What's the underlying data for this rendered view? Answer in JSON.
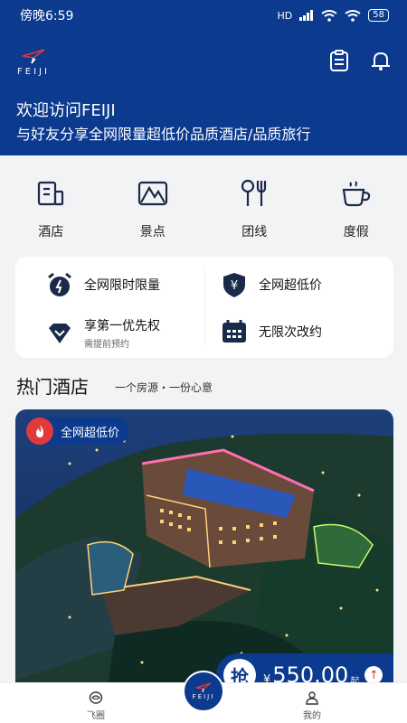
{
  "status": {
    "time": "傍晚6:59",
    "network": "HD",
    "battery": "58"
  },
  "header": {
    "logo_text": "FEIJI",
    "welcome": "欢迎访问FEIJI",
    "slogan": "与好友分享全网限量超低价品质酒店/品质旅行"
  },
  "categories": [
    {
      "label": "酒店",
      "icon": "hotel-icon"
    },
    {
      "label": "景点",
      "icon": "mountain-icon"
    },
    {
      "label": "团线",
      "icon": "tour-icon"
    },
    {
      "label": "度假",
      "icon": "coffee-icon"
    }
  ],
  "features": [
    {
      "title": "全网限时限量",
      "sub": "",
      "icon": "alarm-clock-icon"
    },
    {
      "title": "全网超低价",
      "sub": "",
      "icon": "yen-shield-icon"
    },
    {
      "title": "享第一优先权",
      "sub": "需提前预约",
      "icon": "diamond-icon"
    },
    {
      "title": "无限次改约",
      "sub": "",
      "icon": "calendar-icon"
    }
  ],
  "section": {
    "title": "热门酒店",
    "subtitle": "一个房源・一份心意"
  },
  "hotel": {
    "badge": "全网超低价",
    "grab_label": "抢",
    "currency": "¥",
    "price": "550.00",
    "price_suffix": "起"
  },
  "tabbar": {
    "left_label": "飞圈",
    "center_label": "FEIJI",
    "right_label": "我的"
  },
  "colors": {
    "brand": "#0b3a8e",
    "accent": "#e23a3a"
  }
}
